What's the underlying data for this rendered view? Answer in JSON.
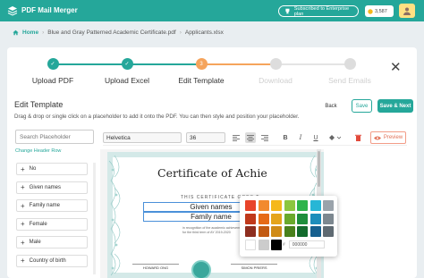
{
  "header": {
    "app_title": "PDF Mail Merger",
    "plan_badge": "Subscribed to Enterprise plan",
    "credits": "3,587"
  },
  "breadcrumb": {
    "home": "Home",
    "template_file": "Blue and Gray Patterned Academic Certificate.pdf",
    "data_file": "Applicants.xlsx"
  },
  "stepper": {
    "steps": [
      {
        "label": "Upload PDF",
        "state": "done",
        "number": ""
      },
      {
        "label": "Upload Excel",
        "state": "done",
        "number": ""
      },
      {
        "label": "Edit Template",
        "state": "active",
        "number": "3"
      },
      {
        "label": "Download",
        "state": "todo",
        "number": ""
      },
      {
        "label": "Send Emails",
        "state": "todo",
        "number": ""
      }
    ]
  },
  "edit_template": {
    "title": "Edit Template",
    "description": "Drag & drop or single click on a placeholder to add it onto the PDF. You can then style and position your placeholder.",
    "back_label": "Back",
    "save_label": "Save",
    "save_next_label": "Save & Next"
  },
  "sidebar": {
    "search_placeholder": "Search Placeholder",
    "change_header_label": "Change Header Row",
    "placeholders": [
      "No",
      "Given names",
      "Family name",
      "Female",
      "Male",
      "Country of birth"
    ]
  },
  "toolbar": {
    "font": "Helvetica",
    "size": "36",
    "preview_label": "Preview"
  },
  "certificate": {
    "title": "Certificate of Achie",
    "goes_to": "THIS CERTIFICATE GOES T",
    "placeholder_given": "Given names",
    "placeholder_family": "Family name",
    "body_text": "in recognition of the academic achievement for the third term of AY 2019-2020",
    "signature_left": "HOWARD ONG",
    "signature_right": "SIMON PRIERS"
  },
  "color_picker": {
    "swatches": [
      "#e8442a",
      "#f28a2e",
      "#f5b81c",
      "#8cc63f",
      "#2eb34a",
      "#27b6d6",
      "#9aa3ab",
      "#c0391b",
      "#e66a16",
      "#e5a51c",
      "#6aaa2c",
      "#1e8f3c",
      "#1d8dbb",
      "#7d8890",
      "#8e2e1f",
      "#c25a12",
      "#cf8b18",
      "#49811c",
      "#136b2d",
      "#165f8e",
      "#5f6a72",
      "#ffffff",
      "#cccccc",
      "#000000"
    ],
    "hex_value": "000000"
  }
}
